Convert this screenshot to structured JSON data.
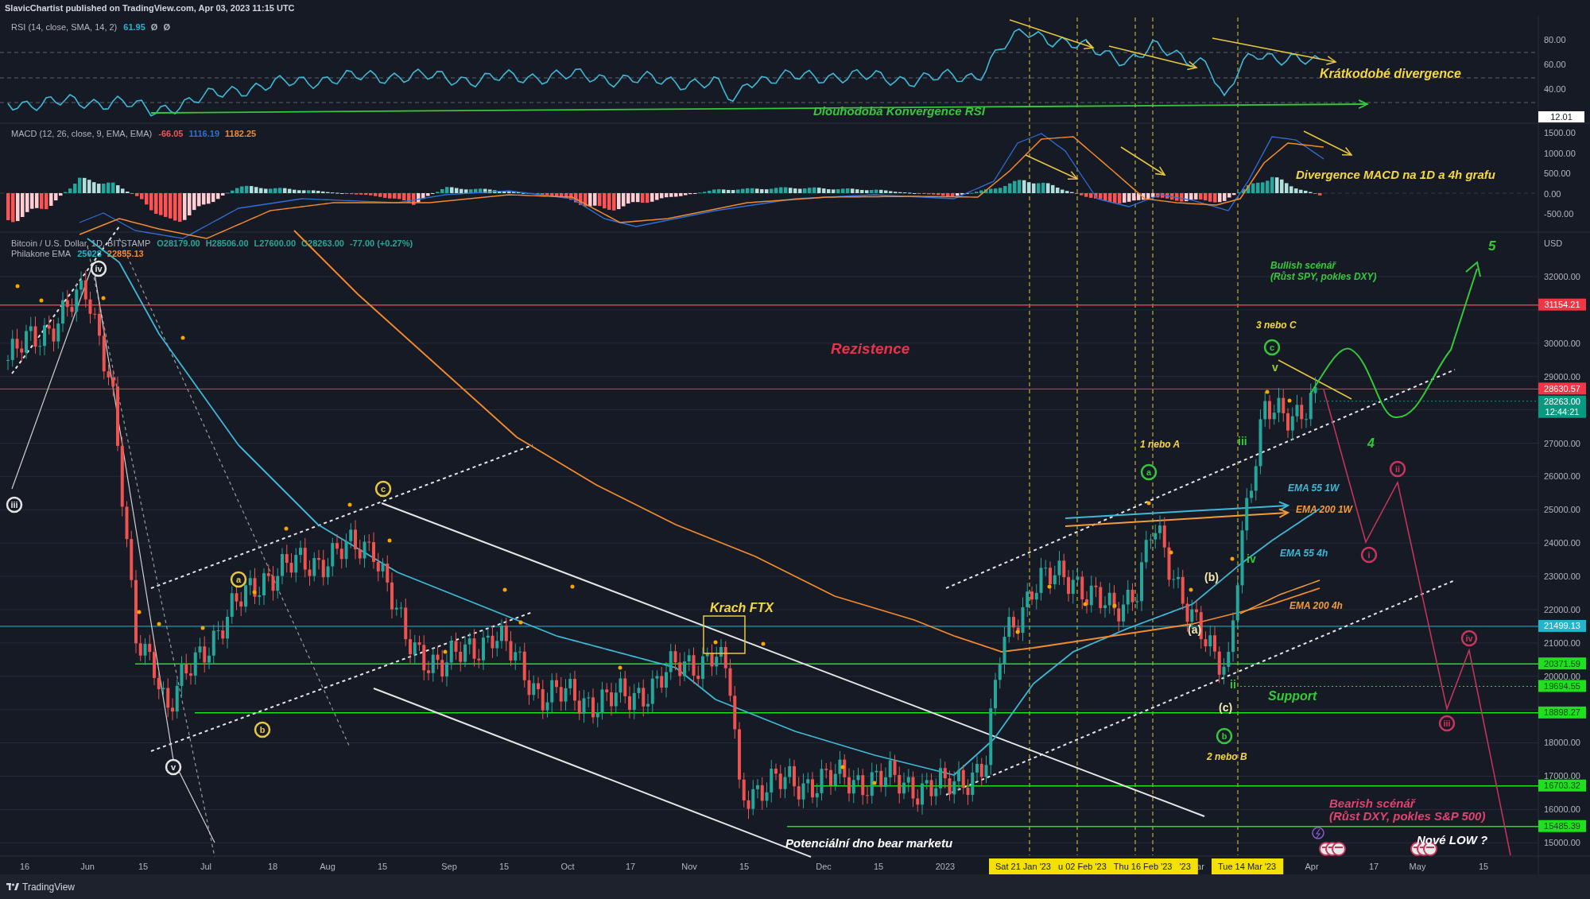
{
  "header": {
    "text": "SlavicChartist published on TradingView.com, Apr 03, 2023 11:15 UTC"
  },
  "rsi_pane": {
    "legend": {
      "title": "RSI (14, close, SMA, 14, 2)",
      "values": [
        {
          "text": "61.95",
          "color": "#22b5d0"
        },
        {
          "text": "Ø",
          "color": "#b2b5be"
        },
        {
          "text": "Ø",
          "color": "#b2b5be"
        }
      ]
    },
    "axis_labels": [
      "80.00",
      "60.00",
      "40.00"
    ],
    "value_tag": "12.01"
  },
  "macd_pane": {
    "legend": {
      "title": "MACD (12, 26, close, 9, EMA, EMA)",
      "values": [
        {
          "text": "-66.05",
          "color": "#f0555a"
        },
        {
          "text": "1116.19",
          "color": "#2f6fd6"
        },
        {
          "text": "1182.25",
          "color": "#f28a2e"
        }
      ]
    },
    "axis_labels": [
      "1500.00",
      "1000.00",
      "500.00",
      "0.00",
      "-500.00"
    ]
  },
  "price_pane": {
    "legends": [
      {
        "title": "Bitcoin / U.S. Dollar, 1D, BITSTAMP",
        "values": [
          {
            "text": "O28179.00",
            "color": "#26a69a"
          },
          {
            "text": "H28506.00",
            "color": "#26a69a"
          },
          {
            "text": "L27600.00",
            "color": "#26a69a"
          },
          {
            "text": "C28263.00",
            "color": "#26a69a"
          },
          {
            "text": "-77.00 (+0.27%)",
            "color": "#26a69a"
          }
        ]
      },
      {
        "title": "Philakone EMA",
        "values": [
          {
            "text": "25028",
            "color": "#22b5d0"
          },
          {
            "text": "22855.13",
            "color": "#f28a2e"
          }
        ]
      }
    ],
    "currency": "USD",
    "axis_labels": [
      "32000.00",
      "30000.00",
      "29000.00",
      "27000.00",
      "26000.00",
      "25000.00",
      "24000.00",
      "23000.00",
      "22000.00",
      "21000.00",
      "20000.00",
      "18000.00",
      "17000.00",
      "16000.00",
      "15000.00"
    ],
    "price_tags": [
      {
        "text": "31154.21",
        "color": "#f23645"
      },
      {
        "text": "28630.57",
        "color": "#f23645"
      },
      {
        "text": "28263.00",
        "subtext": "12:44:21",
        "color": "#089981"
      },
      {
        "text": "21499.13",
        "color": "#22b5d0"
      },
      {
        "text": "20371.59",
        "color": "#1ee01e"
      },
      {
        "text": "19694.55",
        "color": "#1ee01e"
      },
      {
        "text": "18898.27",
        "color": "#1ee01e"
      },
      {
        "text": "16703.32",
        "color": "#1ee01e"
      },
      {
        "text": "15485.39",
        "color": "#1ee01e"
      }
    ]
  },
  "annotations": [
    {
      "kind": "text",
      "text": "Krátkodobé divergence",
      "color": "#f5d742"
    },
    {
      "kind": "text",
      "text": "Dlouhodobá Konvergence RSI",
      "color": "#35c83a"
    },
    {
      "kind": "text",
      "text": "Divergence MACD na 1D a 4h grafu",
      "color": "#f5d742"
    },
    {
      "kind": "text",
      "text": "Rezistence",
      "color": "#e8334a"
    },
    {
      "kind": "text",
      "text": "Krach FTX",
      "color": "#f5d742"
    },
    {
      "kind": "text",
      "text": "Potenciální dno bear marketu",
      "color": "#ffffff"
    },
    {
      "kind": "text",
      "text": "Bullish scénář",
      "color": "#35c83a"
    },
    {
      "kind": "text",
      "text": "(Růst SPY, pokles DXY)",
      "color": "#35c83a"
    },
    {
      "kind": "text",
      "text": "5",
      "color": "#35c83a"
    },
    {
      "kind": "text",
      "text": "3 nebo C",
      "color": "#f5d742"
    },
    {
      "kind": "text",
      "text": "1 nebo A",
      "color": "#f5d742"
    },
    {
      "kind": "text",
      "text": "4",
      "color": "#35c83a"
    },
    {
      "kind": "text",
      "text": "EMA 55 1W",
      "color": "#3fb8d6"
    },
    {
      "kind": "text",
      "text": "EMA 200 1W",
      "color": "#f29b38"
    },
    {
      "kind": "text",
      "text": "EMA 55 4h",
      "color": "#3fb8d6"
    },
    {
      "kind": "text",
      "text": "EMA 200 4h",
      "color": "#f29b38"
    },
    {
      "kind": "text",
      "text": "Support",
      "color": "#35c83a"
    },
    {
      "kind": "text",
      "text": "2 nebo B",
      "color": "#f5d742"
    },
    {
      "kind": "text",
      "text": "Bearish scénář",
      "color": "#e0436f"
    },
    {
      "kind": "text",
      "text": "(Růst DXY, pokles S&P 500)",
      "color": "#e0436f"
    },
    {
      "kind": "text",
      "text": "Nové LOW ?",
      "color": "#ffffff"
    },
    {
      "kind": "text",
      "text": "(b)",
      "color": "#f2e6b0"
    },
    {
      "kind": "text",
      "text": "(a)",
      "color": "#f2e6b0"
    },
    {
      "kind": "text",
      "text": "(c)",
      "color": "#f2e6b0"
    },
    {
      "kind": "text",
      "text": "v",
      "color": "#9ccc3a"
    },
    {
      "kind": "text",
      "text": "iii",
      "color": "#35c83a"
    },
    {
      "kind": "text",
      "text": "iv",
      "color": "#35c83a"
    },
    {
      "kind": "text",
      "text": "ii",
      "color": "#35c83a"
    },
    {
      "kind": "circle",
      "text": "iv",
      "color": "#e6e6e6"
    },
    {
      "kind": "circle",
      "text": "iii",
      "color": "#e6e6e6"
    },
    {
      "kind": "circle",
      "text": "v",
      "color": "#e6e6e6"
    },
    {
      "kind": "circle",
      "text": "c",
      "color": "#e8c840"
    },
    {
      "kind": "circle",
      "text": "a",
      "color": "#e8c840"
    },
    {
      "kind": "circle",
      "text": "b",
      "color": "#e8c840"
    },
    {
      "kind": "circle",
      "text": "a",
      "color": "#35c83a"
    },
    {
      "kind": "circle",
      "text": "c",
      "color": "#35c83a"
    },
    {
      "kind": "circle",
      "text": "b",
      "color": "#35c83a"
    },
    {
      "kind": "circle",
      "text": "i",
      "color": "#c8365e"
    },
    {
      "kind": "circle",
      "text": "ii",
      "color": "#c8365e"
    },
    {
      "kind": "circle",
      "text": "iii",
      "color": "#c8365e"
    },
    {
      "kind": "circle",
      "text": "iv",
      "color": "#c8365e"
    }
  ],
  "time_axis": {
    "labels": [
      "16",
      "Jun",
      "15",
      "Jul",
      "18",
      "Aug",
      "15",
      "Sep",
      "15",
      "Oct",
      "17",
      "Nov",
      "15",
      "Dec",
      "15",
      "2023",
      "ar",
      "Apr",
      "17",
      "May",
      "15"
    ],
    "highlight_tags": [
      {
        "labels": [
          "Sat 21 Jan '23",
          "u 02 Feb '23",
          "Thu 16 Feb '23",
          "'23"
        ]
      },
      {
        "labels": [
          "Tue 14 Mar '23"
        ]
      }
    ]
  },
  "footer": {
    "brand": "TradingView"
  }
}
